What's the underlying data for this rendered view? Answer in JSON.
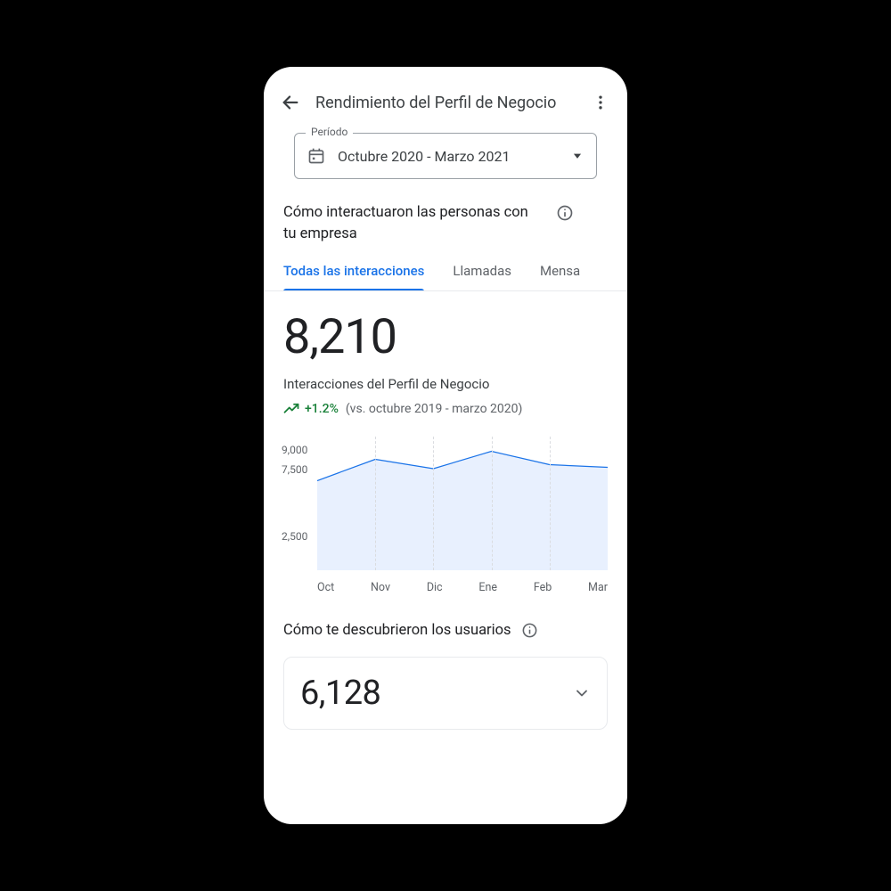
{
  "appbar": {
    "title": "Rendimiento del Perfil de Negocio"
  },
  "period": {
    "legend": "Período",
    "value": "Octubre 2020 - Marzo 2021"
  },
  "interaction_section": {
    "heading": "Cómo interactuaron las personas con tu empresa"
  },
  "tabs": {
    "items": [
      {
        "label": "Todas las interacciones",
        "active": true
      },
      {
        "label": "Llamadas",
        "active": false
      },
      {
        "label": "Mensa",
        "active": false
      }
    ]
  },
  "metric": {
    "value": "8,210",
    "label": "Interacciones del Perfil de Negocio",
    "delta_pct": "+1.2%",
    "compare_text": "(vs. octubre 2019 - marzo 2020)"
  },
  "discover": {
    "heading": "Cómo te descubrieron los usuarios",
    "card_value": "6,128"
  },
  "chart_data": {
    "type": "area",
    "categories": [
      "Oct",
      "Nov",
      "Dic",
      "Ene",
      "Feb",
      "Mar"
    ],
    "values": [
      6700,
      8300,
      7600,
      8900,
      7900,
      7700
    ],
    "y_ticks": [
      9000,
      7500,
      2500
    ],
    "y_tick_labels": [
      "9,000",
      "7,500",
      "2,500"
    ],
    "ylim": [
      0,
      10000
    ],
    "line_color": "#1a73e8",
    "fill_color": "#e8f0fe",
    "title": "",
    "xlabel": "",
    "ylabel": ""
  }
}
